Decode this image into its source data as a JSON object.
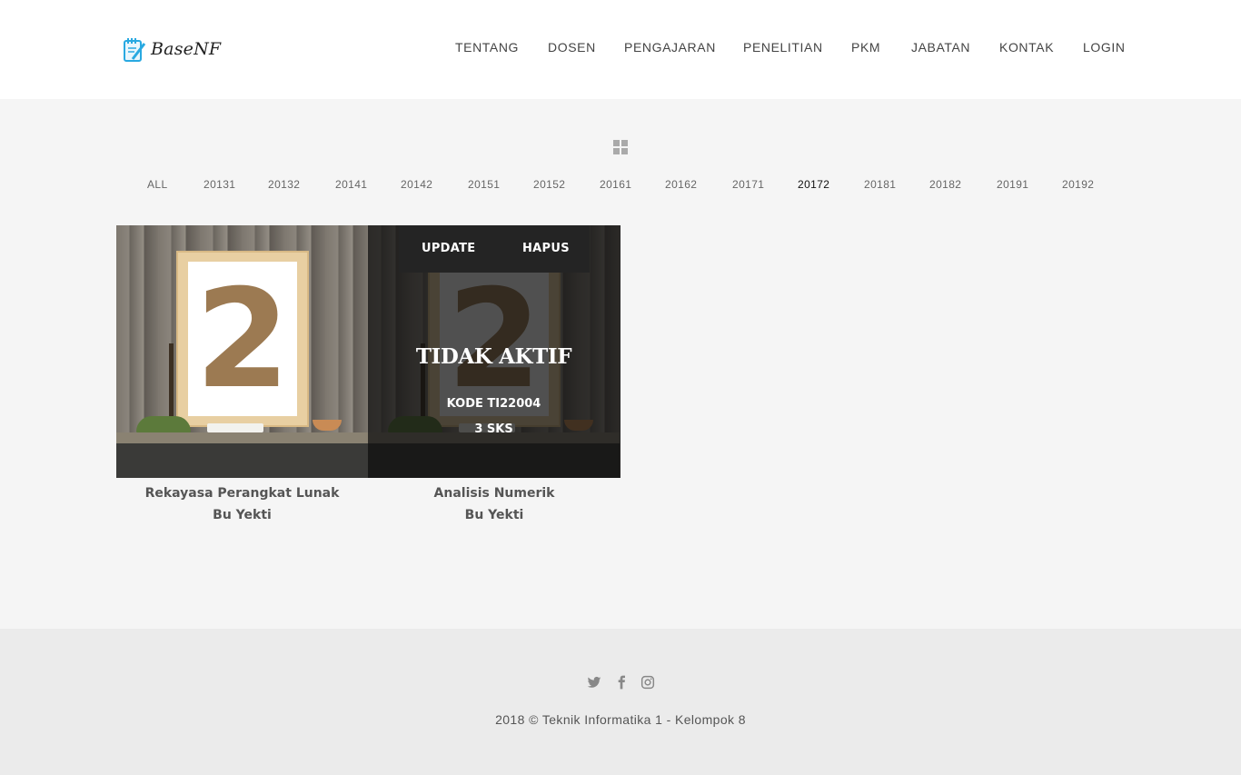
{
  "brand": {
    "name": "BaseNF"
  },
  "nav": {
    "items": [
      "TENTANG",
      "DOSEN",
      "PENGAJARAN",
      "PENELITIAN",
      "PKM",
      "JABATAN",
      "KONTAK",
      "LOGIN"
    ]
  },
  "filters": {
    "items": [
      "ALL",
      "20131",
      "20132",
      "20141",
      "20142",
      "20151",
      "20152",
      "20161",
      "20162",
      "20171",
      "20172",
      "20181",
      "20182",
      "20191",
      "20192"
    ],
    "active": "20172"
  },
  "courses": [
    {
      "title": "Rekayasa Perangkat Lunak",
      "lecturer": "Bu Yekti",
      "poster_number": "2"
    },
    {
      "title": "Analisis Numerik",
      "lecturer": "Bu Yekti",
      "poster_number": "2",
      "overlay": {
        "update_label": "UPDATE",
        "delete_label": "HAPUS",
        "status": "TIDAK AKTIF",
        "kode": "KODE TI22004",
        "sks": "3 SKS"
      }
    }
  ],
  "footer": {
    "socials": [
      "twitter-icon",
      "facebook-icon",
      "instagram-icon"
    ],
    "copyright": "2018 © Teknik Informatika 1 - Kelompok 8"
  }
}
